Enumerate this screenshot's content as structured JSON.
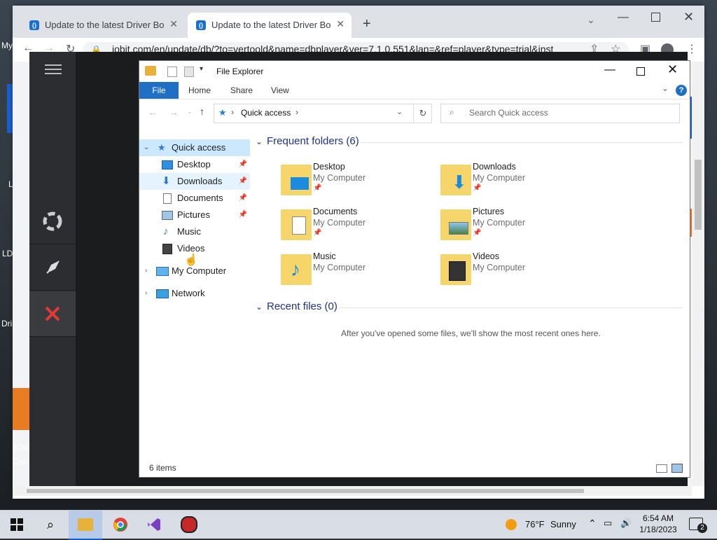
{
  "desktop": {
    "icons": [
      {
        "label": "My"
      },
      {
        "label": "L"
      },
      {
        "label": "LD"
      },
      {
        "label": "Dri"
      },
      {
        "label": "IObi"
      },
      {
        "label": "Con"
      }
    ]
  },
  "browser": {
    "tabs": [
      {
        "title": "Update to the latest Driver Booster",
        "favicon": "iobit-favicon",
        "active": false
      },
      {
        "title": "Update to the latest Driver Booster",
        "favicon": "iobit-favicon",
        "active": true
      }
    ],
    "url": "iobit.com/en/update/db/?to=vertoold&name=dbplayer&ver=7.1.0.551&lan=&ref=player&type=trial&inst",
    "new_tab_label": "+"
  },
  "driver_booster": {
    "menu_icon": "hamburger-icon",
    "side_tiles": [
      "lifebuoy-icon",
      "rocket-icon",
      "tools-icon"
    ],
    "accent": "#e53935"
  },
  "explorer": {
    "title": "File Explorer",
    "ribbon_tabs": [
      "File",
      "Home",
      "Share",
      "View"
    ],
    "breadcrumb": "Quick access",
    "search_placeholder": "Search Quick access",
    "nav": {
      "quick_access": "Quick access",
      "items": [
        {
          "label": "Desktop",
          "pinned": true
        },
        {
          "label": "Downloads",
          "pinned": true
        },
        {
          "label": "Documents",
          "pinned": true
        },
        {
          "label": "Pictures",
          "pinned": true
        },
        {
          "label": "Music",
          "pinned": false
        },
        {
          "label": "Videos",
          "pinned": false
        }
      ],
      "my_computer": "My Computer",
      "network": "Network"
    },
    "frequent_header": "Frequent folders (6)",
    "folders": [
      {
        "name": "Desktop",
        "location": "My Computer",
        "pinned": true
      },
      {
        "name": "Downloads",
        "location": "My Computer",
        "pinned": true
      },
      {
        "name": "Documents",
        "location": "My Computer",
        "pinned": true
      },
      {
        "name": "Pictures",
        "location": "My Computer",
        "pinned": true
      },
      {
        "name": "Music",
        "location": "My Computer",
        "pinned": false
      },
      {
        "name": "Videos",
        "location": "My Computer",
        "pinned": false
      }
    ],
    "recent_header": "Recent files (0)",
    "recent_empty": "After you've opened some files, we'll show the most recent ones here.",
    "status": "6 items"
  },
  "taskbar": {
    "weather_temp": "76°F",
    "weather_desc": "Sunny",
    "time": "6:54 AM",
    "date": "1/18/2023",
    "notification_count": "2"
  }
}
